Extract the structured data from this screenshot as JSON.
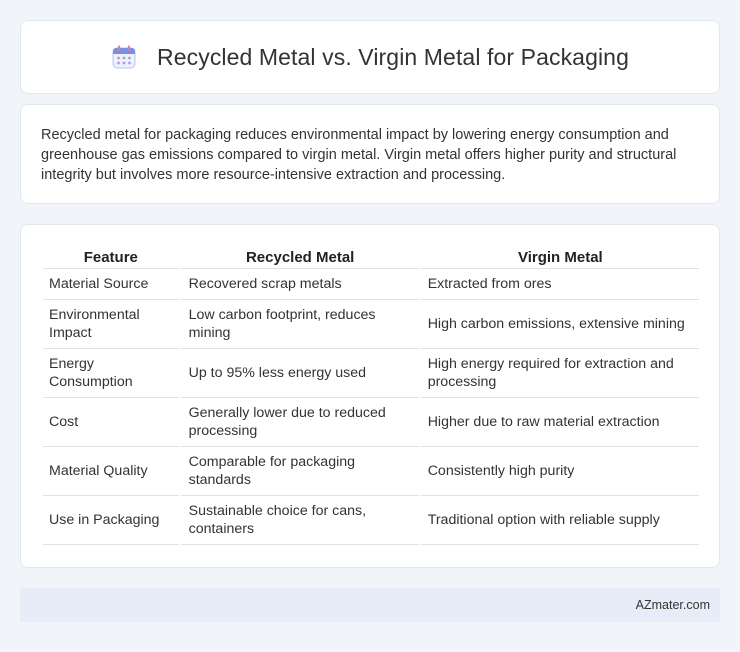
{
  "header": {
    "icon": "calendar-icon",
    "title": "Recycled Metal vs. Virgin Metal for Packaging"
  },
  "summary": {
    "text": "Recycled metal for packaging reduces environmental impact by lowering energy consumption and greenhouse gas emissions compared to virgin metal. Virgin metal offers higher purity and structural integrity but involves more resource-intensive extraction and processing."
  },
  "table": {
    "headers": [
      "Feature",
      "Recycled Metal",
      "Virgin Metal"
    ],
    "rows": [
      [
        "Material Source",
        "Recovered scrap metals",
        "Extracted from ores"
      ],
      [
        "Environmental Impact",
        "Low carbon footprint, reduces mining",
        "High carbon emissions, extensive mining"
      ],
      [
        "Energy Consumption",
        "Up to 95% less energy used",
        "High energy required for extraction and processing"
      ],
      [
        "Cost",
        "Generally lower due to reduced processing",
        "Higher due to raw material extraction"
      ],
      [
        "Material Quality",
        "Comparable for packaging standards",
        "Consistently high purity"
      ],
      [
        "Use in Packaging",
        "Sustainable choice for cans, containers",
        "Traditional option with reliable supply"
      ]
    ]
  },
  "footer": {
    "brand": "AZmater.com"
  },
  "colors": {
    "page_bg": "#f1f4f8",
    "footer_bg": "#e7edf8",
    "icon_accent": "#7b8fe0"
  }
}
